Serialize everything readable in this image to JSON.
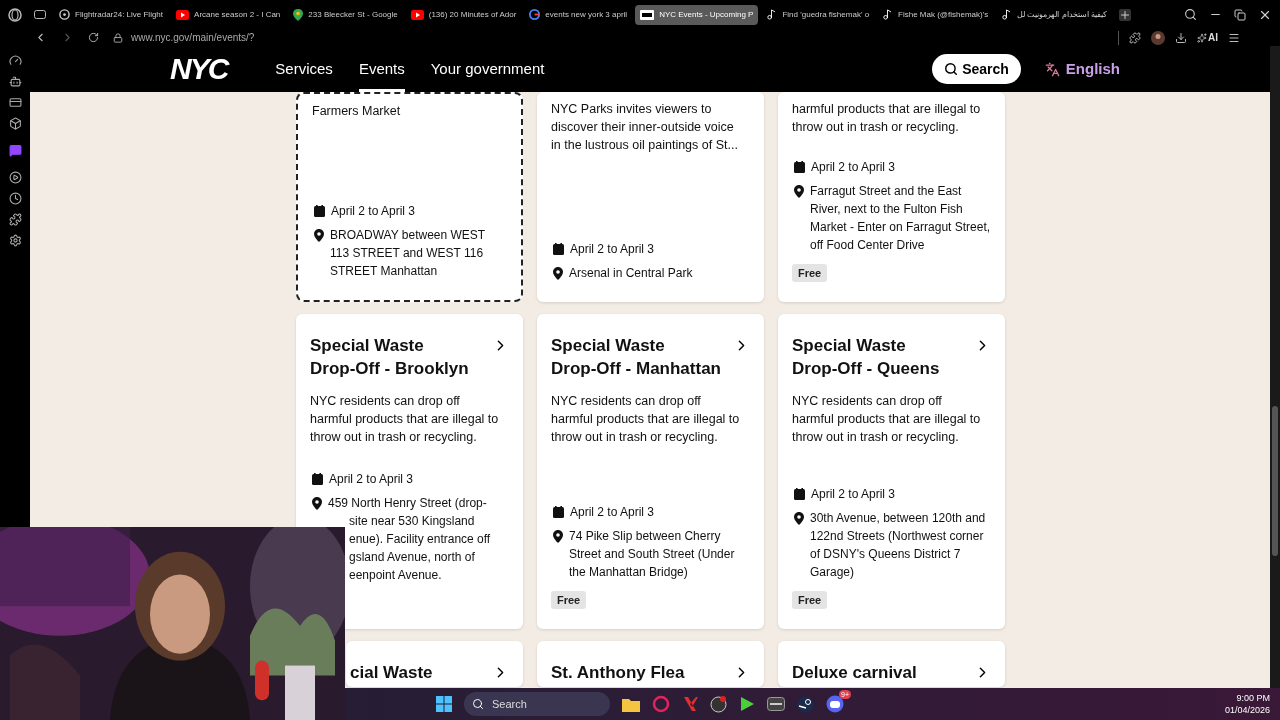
{
  "browser": {
    "tabs": [
      {
        "title": "Flightradar24: Live Flight",
        "kind": "radar",
        "selected": false
      },
      {
        "title": "Arcane season 2 - I Can",
        "kind": "video",
        "selected": false
      },
      {
        "title": "233 Bleecker St - Google",
        "kind": "map",
        "selected": false
      },
      {
        "title": "(136) 20 Minutes of Ador",
        "kind": "video",
        "selected": false
      },
      {
        "title": "events new york 3 april",
        "kind": "search",
        "selected": false
      },
      {
        "title": "NYC Events - Upcoming P",
        "kind": "site",
        "selected": true
      },
      {
        "title": "Find 'guedra fishemak' o",
        "kind": "note",
        "selected": false
      },
      {
        "title": "Fishe Mak (@fishemak)'s",
        "kind": "note",
        "selected": false
      },
      {
        "title": "كيفية استخدام الهرمونيت لل",
        "kind": "note",
        "selected": false
      }
    ],
    "address": "www.nyc.gov/main/events/?",
    "ai_label": "AI"
  },
  "site_header": {
    "logo": "NYC",
    "nav": [
      {
        "label": "Services",
        "selected": false
      },
      {
        "label": "Events",
        "selected": true
      },
      {
        "label": "Your government",
        "selected": false
      }
    ],
    "search_button": "Search",
    "language": "English"
  },
  "events": [
    {
      "description": "Farmers Market",
      "date": "April 2 to April 3",
      "location": [
        "BROADWAY between WEST 113 STREET and WEST 116 STREET Manhattan"
      ],
      "focused": true,
      "partly_hidden": false
    },
    {
      "description": "NYC Parks invites viewers to discover their inner-outside voice in the lustrous oil paintings of St...",
      "date": "April 2 to April 3",
      "location": [
        "Arsenal in Central Park"
      ],
      "focused": false,
      "partly_hidden": false
    },
    {
      "description": "harmful products that are illegal to throw out in trash or recycling.",
      "date": "April 2 to April 3",
      "location": [
        "Farragut Street and the East River, next to the Fulton Fish Market - Enter on Farragut Street, off Food Center Drive"
      ],
      "tag": "Free",
      "focused": false,
      "partly_hidden": false
    },
    {
      "title": "Special Waste Drop-Off - Brooklyn",
      "description": "NYC residents can drop off harmful products that are illegal to throw out in trash or recycling.",
      "date": "April 2 to April 3",
      "location": [
        "459 North Henry Street (drop-",
        "site near 530 Kingsland",
        "enue). Facility entrance off",
        "gsland Avenue, north of",
        "eenpoint Avenue."
      ],
      "focused": false,
      "partly_hidden": true
    },
    {
      "title": "Special Waste Drop-Off - Manhattan",
      "description": "NYC residents can drop off harmful products that are illegal to throw out in trash or recycling.",
      "date": "April 2 to April 3",
      "location": [
        "74 Pike Slip between Cherry Street and South Street (Under the Manhattan Bridge)"
      ],
      "tag": "Free",
      "focused": false,
      "partly_hidden": false
    },
    {
      "title": "Special Waste Drop-Off - Queens",
      "description": "NYC residents can drop off harmful products that are illegal to throw out in trash or recycling.",
      "date": "April 2 to April 3",
      "location": [
        "30th Avenue, between 120th and 122nd Streets (Northwest corner of DSNY's Queens District 7 Garage)"
      ],
      "tag": "Free",
      "focused": false,
      "partly_hidden": false
    },
    {
      "title": "cial Waste",
      "focused": false,
      "partly_hidden": true
    },
    {
      "title": "St. Anthony Flea",
      "focused": false,
      "partly_hidden": false
    },
    {
      "title": "Deluxe carnival",
      "focused": false,
      "partly_hidden": false
    }
  ],
  "taskbar": {
    "search_placeholder": "Search",
    "badge": "9+",
    "time": "9:00 PM",
    "date": "01/04/2026"
  }
}
